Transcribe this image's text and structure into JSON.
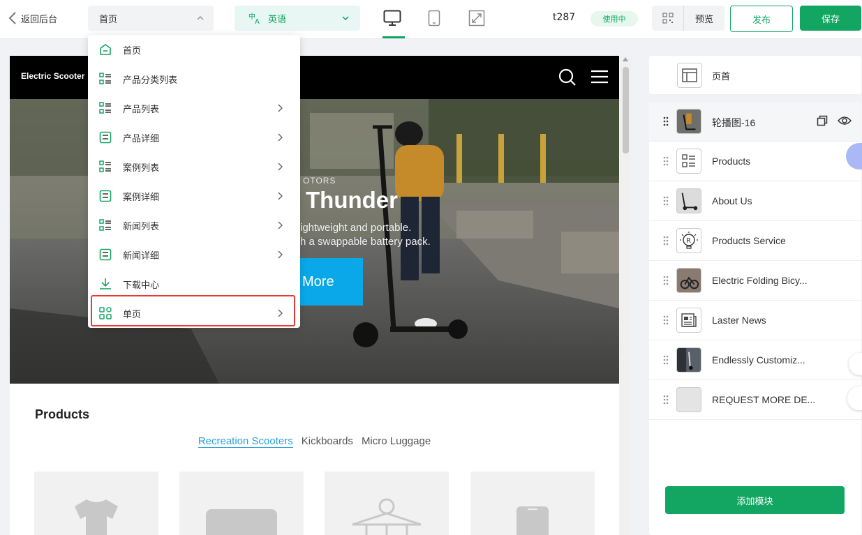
{
  "topbar": {
    "back_label": "返回后台",
    "page_select": "首页",
    "language_select": "英语",
    "site_code": "t287",
    "status_badge": "使用中",
    "preview_label": "预览",
    "publish_label": "发布",
    "save_label": "保存",
    "devices": [
      "desktop-icon",
      "tablet-icon",
      "fullscreen-icon"
    ],
    "active_device": "desktop"
  },
  "page_menu": {
    "items": [
      {
        "label": "首页",
        "icon": "home-icon",
        "has_submenu": false
      },
      {
        "label": "产品分类列表",
        "icon": "list-icon",
        "has_submenu": false
      },
      {
        "label": "产品列表",
        "icon": "list-icon",
        "has_submenu": true
      },
      {
        "label": "产品详细",
        "icon": "detail-icon",
        "has_submenu": true
      },
      {
        "label": "案例列表",
        "icon": "list-icon",
        "has_submenu": true
      },
      {
        "label": "案例详细",
        "icon": "detail-icon",
        "has_submenu": true
      },
      {
        "label": "新闻列表",
        "icon": "list-icon",
        "has_submenu": true
      },
      {
        "label": "新闻详细",
        "icon": "detail-icon",
        "has_submenu": true
      },
      {
        "label": "下载中心",
        "icon": "download-icon",
        "has_submenu": false
      },
      {
        "label": "单页",
        "icon": "grid-icon",
        "has_submenu": true,
        "highlighted": true
      }
    ]
  },
  "preview": {
    "logo": "Electric Scooter",
    "hero": {
      "eyebrow": "OTORS",
      "title": "Thunder",
      "subtitle_line1": "ightweight and portable.",
      "subtitle_line2": "h a swappable battery pack.",
      "button": "More"
    },
    "products_title": "Products",
    "category_tabs": [
      "Recreation Scooters",
      "Kickboards",
      "Micro Luggage"
    ],
    "active_tab": "Recreation Scooters"
  },
  "panel": {
    "header_label": "页首",
    "modules": [
      {
        "label": "轮播图-16",
        "thumb": "scooter-photo",
        "selected": true
      },
      {
        "label": "Products",
        "thumb": "list-icon"
      },
      {
        "label": "About Us",
        "thumb": "scooter-photo"
      },
      {
        "label": "Products Service",
        "thumb": "bulb-icon"
      },
      {
        "label": "Electric Folding Bicy...",
        "thumb": "bicycle-photo"
      },
      {
        "label": "Laster News",
        "thumb": "news-icon"
      },
      {
        "label": "Endlessly Customiz...",
        "thumb": "scooter-photo"
      },
      {
        "label": "REQUEST MORE DE...",
        "thumb": "blank"
      }
    ],
    "add_module_label": "添加模块"
  },
  "colors": {
    "accent": "#13a662",
    "highlight_border": "#e53935",
    "hero_button": "#0aa8e8",
    "active_tab": "#2a9fd8"
  }
}
